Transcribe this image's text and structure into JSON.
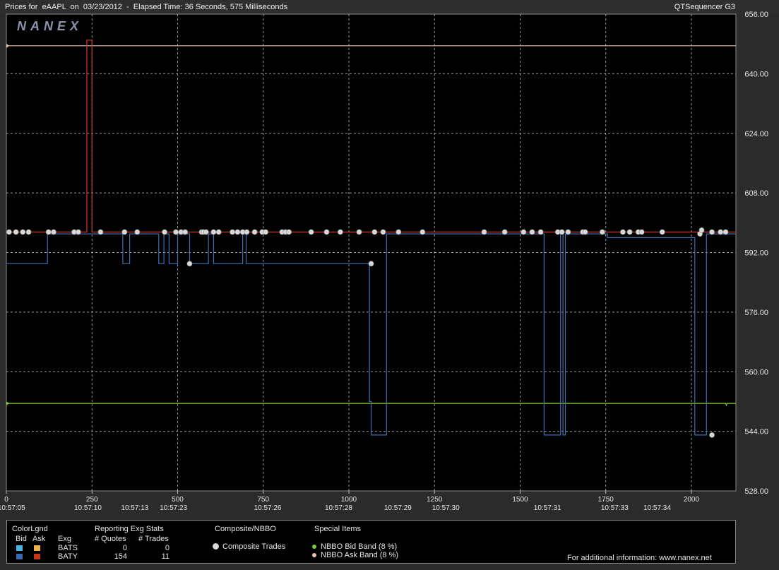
{
  "header": {
    "title": "Prices for  eAAPL  on  03/23/2012  -  Elapsed Time: 36 Seconds, 575 Milliseconds",
    "brand": "QTSequencer G3",
    "logo": "NANEX"
  },
  "colors": {
    "background": "#000000",
    "grid": "#bfbfbf",
    "ask_line": "#d13a2a",
    "bid_line": "#3f6fb3",
    "bid_band": "#7ccc34",
    "ask_band": "#e9c4b4",
    "trade_dot": "#d9d9d9"
  },
  "chart_data": {
    "type": "line",
    "ylim": [
      528,
      656
    ],
    "xlim": [
      0,
      2130
    ],
    "y_ticks": [
      "528.00",
      "544.00",
      "560.00",
      "576.00",
      "592.00",
      "608.00",
      "624.00",
      "640.00",
      "656.00"
    ],
    "x_ticks": [
      0,
      250,
      500,
      750,
      1000,
      1250,
      1500,
      1750,
      2000
    ],
    "time_labels": [
      {
        "x": 15,
        "label": "10:57:05"
      },
      {
        "x": 238,
        "label": "10:57:10"
      },
      {
        "x": 375,
        "label": "10:57:13"
      },
      {
        "x": 488,
        "label": "10:57:23"
      },
      {
        "x": 763,
        "label": "10:57:26"
      },
      {
        "x": 970,
        "label": "10:57:28"
      },
      {
        "x": 1143,
        "label": "10:57:29"
      },
      {
        "x": 1283,
        "label": "10:57:30"
      },
      {
        "x": 1580,
        "label": "10:57:31"
      },
      {
        "x": 1776,
        "label": "10:57:33"
      },
      {
        "x": 1900,
        "label": "10:57:34"
      }
    ],
    "series": [
      {
        "name": "NBBO Ask Band (8 %)",
        "points": [
          [
            0,
            647.5
          ],
          [
            2130,
            647.5
          ]
        ]
      },
      {
        "name": "NBBO Bid Band (8 %)",
        "points": [
          [
            0,
            551.5
          ],
          [
            2100,
            551.5
          ],
          [
            2102,
            551.0
          ],
          [
            2104,
            551.5
          ],
          [
            2130,
            551.5
          ]
        ]
      },
      {
        "name": "BATY Ask",
        "points": [
          [
            0,
            597.5
          ],
          [
            235,
            597.5
          ],
          [
            235,
            649
          ],
          [
            250,
            649
          ],
          [
            250,
            597.5
          ],
          [
            2130,
            597.5
          ]
        ]
      },
      {
        "name": "BATY Bid",
        "points": [
          [
            0,
            589
          ],
          [
            120,
            589
          ],
          [
            120,
            597
          ],
          [
            340,
            597
          ],
          [
            340,
            589
          ],
          [
            360,
            589
          ],
          [
            360,
            597
          ],
          [
            445,
            597
          ],
          [
            445,
            589
          ],
          [
            460,
            589
          ],
          [
            460,
            597
          ],
          [
            475,
            597
          ],
          [
            475,
            589
          ],
          [
            500,
            589
          ],
          [
            500,
            597
          ],
          [
            535,
            597
          ],
          [
            535,
            589
          ],
          [
            590,
            589
          ],
          [
            590,
            597
          ],
          [
            605,
            597
          ],
          [
            605,
            589
          ],
          [
            690,
            589
          ],
          [
            690,
            597
          ],
          [
            700,
            597
          ],
          [
            700,
            589
          ],
          [
            1060,
            589
          ],
          [
            1060,
            552
          ],
          [
            1065,
            552
          ],
          [
            1065,
            543
          ],
          [
            1110,
            543
          ],
          [
            1110,
            597
          ],
          [
            1570,
            597
          ],
          [
            1570,
            543
          ],
          [
            1618,
            543
          ],
          [
            1618,
            597
          ],
          [
            1625,
            597
          ],
          [
            1625,
            543
          ],
          [
            1632,
            543
          ],
          [
            1632,
            597
          ],
          [
            1755,
            597
          ],
          [
            1755,
            596
          ],
          [
            2010,
            596
          ],
          [
            2010,
            543
          ],
          [
            2044,
            543
          ],
          [
            2044,
            597
          ],
          [
            2130,
            597
          ]
        ]
      }
    ],
    "trades": [
      [
        8,
        597.5
      ],
      [
        28,
        597.5
      ],
      [
        48,
        597.5
      ],
      [
        65,
        597.5
      ],
      [
        123,
        597.5
      ],
      [
        138,
        597.5
      ],
      [
        198,
        597.5
      ],
      [
        210,
        597.5
      ],
      [
        275,
        597.5
      ],
      [
        345,
        597.5
      ],
      [
        382,
        597.5
      ],
      [
        462,
        597.5
      ],
      [
        495,
        597.5
      ],
      [
        510,
        597.5
      ],
      [
        522,
        597.5
      ],
      [
        535,
        589
      ],
      [
        570,
        597.5
      ],
      [
        575,
        597.5
      ],
      [
        583,
        597.5
      ],
      [
        605,
        597.5
      ],
      [
        620,
        597.5
      ],
      [
        660,
        597.5
      ],
      [
        675,
        597.5
      ],
      [
        690,
        597.5
      ],
      [
        702,
        597.5
      ],
      [
        725,
        597.5
      ],
      [
        747,
        597.5
      ],
      [
        757,
        597.5
      ],
      [
        805,
        597.5
      ],
      [
        815,
        597.5
      ],
      [
        825,
        597.5
      ],
      [
        890,
        597.5
      ],
      [
        935,
        597.5
      ],
      [
        975,
        597.5
      ],
      [
        1030,
        597.5
      ],
      [
        1065,
        589
      ],
      [
        1075,
        597.5
      ],
      [
        1100,
        597.5
      ],
      [
        1145,
        597.5
      ],
      [
        1215,
        597.5
      ],
      [
        1395,
        597.5
      ],
      [
        1455,
        597.5
      ],
      [
        1510,
        597.5
      ],
      [
        1535,
        597.5
      ],
      [
        1560,
        597.5
      ],
      [
        1610,
        597.5
      ],
      [
        1622,
        597.5
      ],
      [
        1640,
        597.5
      ],
      [
        1683,
        597.5
      ],
      [
        1690,
        597.5
      ],
      [
        1740,
        597.5
      ],
      [
        1800,
        597.5
      ],
      [
        1820,
        597.5
      ],
      [
        1845,
        597.5
      ],
      [
        1855,
        597.5
      ],
      [
        1915,
        597.5
      ],
      [
        2025,
        597
      ],
      [
        2030,
        598
      ],
      [
        2060,
        597.5
      ],
      [
        2085,
        597.5
      ],
      [
        2100,
        597.5
      ],
      [
        2060,
        543
      ]
    ]
  },
  "legend": {
    "colorlgnd_title": "ColorLgnd",
    "bid_label": "Bid",
    "ask_label": "Ask",
    "exg_label": "Exg",
    "stats_title": "Reporting Exg Stats",
    "quotes_header": "# Quotes",
    "trades_header": "# Trades",
    "rows": [
      {
        "exg": "BATS",
        "quotes": "0",
        "trades": "0",
        "bid_color": "#49b4e8",
        "ask_color": "#f1b143"
      },
      {
        "exg": "BATY",
        "quotes": "154",
        "trades": "11",
        "bid_color": "#3a6ab4",
        "ask_color": "#c8361d"
      }
    ],
    "composite_title": "Composite/NBBO",
    "composite_trades": "Composite Trades",
    "special_title": "Special Items",
    "bid_band": "NBBO Bid Band (8 %)",
    "ask_band": "NBBO Ask Band (8 %)",
    "info": "For additional information: www.nanex.net"
  }
}
